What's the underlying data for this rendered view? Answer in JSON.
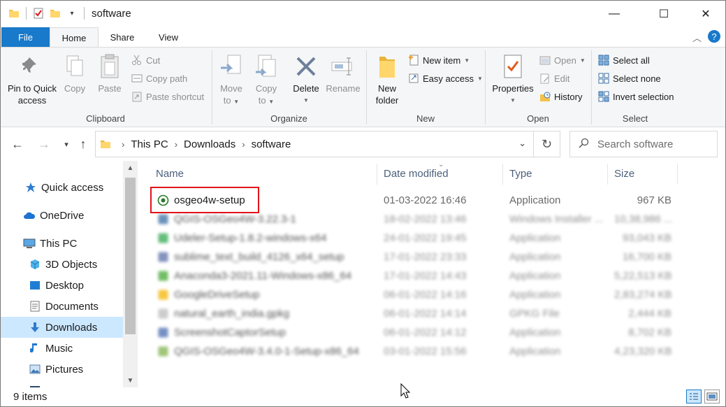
{
  "window": {
    "title": "software",
    "controls": {
      "minimize": "—",
      "maximize": "☐",
      "close": "✕"
    }
  },
  "ribbon": {
    "tabs": [
      "File",
      "Home",
      "Share",
      "View"
    ],
    "active_tab": "Home",
    "groups": {
      "clipboard": {
        "label": "Clipboard",
        "pin_line1": "Pin to Quick",
        "pin_line2": "access",
        "copy": "Copy",
        "paste": "Paste",
        "cut": "Cut",
        "copy_path": "Copy path",
        "paste_shortcut": "Paste shortcut"
      },
      "organize": {
        "label": "Organize",
        "move_line1": "Move",
        "move_line2": "to",
        "copy_line1": "Copy",
        "copy_line2": "to",
        "delete": "Delete",
        "rename": "Rename"
      },
      "new": {
        "label": "New",
        "new_folder_line1": "New",
        "new_folder_line2": "folder",
        "new_item": "New item",
        "easy_access": "Easy access"
      },
      "open": {
        "label": "Open",
        "properties": "Properties",
        "open": "Open",
        "edit": "Edit",
        "history": "History"
      },
      "select": {
        "label": "Select",
        "select_all": "Select all",
        "select_none": "Select none",
        "invert_selection": "Invert selection"
      }
    }
  },
  "address": {
    "crumbs": [
      "This PC",
      "Downloads",
      "software"
    ],
    "search_placeholder": "Search software"
  },
  "nav_pane": {
    "items": [
      {
        "label": "Quick access",
        "icon": "star-icon"
      },
      {
        "label": "OneDrive",
        "icon": "cloud-icon"
      },
      {
        "label": "This PC",
        "icon": "computer-icon"
      },
      {
        "label": "3D Objects",
        "icon": "cube-icon"
      },
      {
        "label": "Desktop",
        "icon": "desktop-icon"
      },
      {
        "label": "Documents",
        "icon": "document-icon"
      },
      {
        "label": "Downloads",
        "icon": "download-icon",
        "selected": true
      },
      {
        "label": "Music",
        "icon": "music-icon"
      },
      {
        "label": "Pictures",
        "icon": "picture-icon"
      }
    ]
  },
  "file_list": {
    "columns": [
      "Name",
      "Date modified",
      "Type",
      "Size"
    ],
    "rows": [
      {
        "name": "osgeo4w-setup",
        "date": "01-03-2022 16:46",
        "type": "Application",
        "size": "967 KB",
        "icon_color": "#2a7a2a",
        "highlighted": true
      },
      {
        "name": "QGIS-OSGeo4W-3.22.3-1",
        "date": "18-02-2022 13:46",
        "type": "Windows Installer ...",
        "size": "10,38,986 ...",
        "icon_color": "#3a6ea5",
        "blurred": true
      },
      {
        "name": "Udeler-Setup-1.8.2-windows-x64",
        "date": "24-01-2022 19:45",
        "type": "Application",
        "size": "93,043 KB",
        "icon_color": "#2fa84f",
        "blurred": true
      },
      {
        "name": "sublime_text_build_4126_x64_setup",
        "date": "17-01-2022 23:33",
        "type": "Application",
        "size": "16,700 KB",
        "icon_color": "#5b6fa8",
        "blurred": true
      },
      {
        "name": "Anaconda3-2021.11-Windows-x86_64",
        "date": "17-01-2022 14:43",
        "type": "Application",
        "size": "5,22,513 KB",
        "icon_color": "#44a833",
        "blurred": true
      },
      {
        "name": "GoogleDriveSetup",
        "date": "06-01-2022 14:16",
        "type": "Application",
        "size": "2,83,274 KB",
        "icon_color": "#f4b400",
        "blurred": true
      },
      {
        "name": "natural_earth_india.gpkg",
        "date": "06-01-2022 14:14",
        "type": "GPKG File",
        "size": "2,444 KB",
        "icon_color": "#bbbbbb",
        "blurred": true
      },
      {
        "name": "ScreenshotCaptorSetup",
        "date": "06-01-2022 14:12",
        "type": "Application",
        "size": "8,702 KB",
        "icon_color": "#4a6cb0",
        "blurred": true
      },
      {
        "name": "QGIS-OSGeo4W-3.4.0-1-Setup-x86_64",
        "date": "03-01-2022 15:56",
        "type": "Application",
        "size": "4,23,320 KB",
        "icon_color": "#7fb24b",
        "blurred": true
      }
    ]
  },
  "status": {
    "items_count": "9 items"
  },
  "colors": {
    "accent": "#1979ca",
    "selection": "#cce8ff",
    "highlight_box": "#e0141b"
  }
}
